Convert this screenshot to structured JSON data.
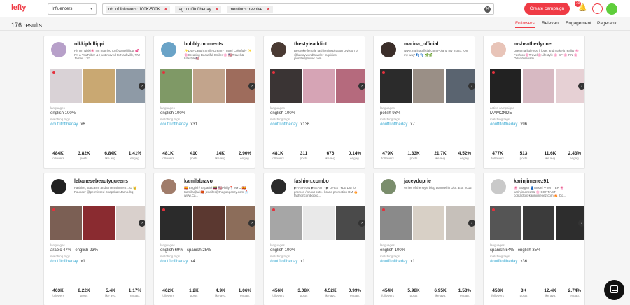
{
  "header": {
    "logo": "lefty",
    "type_dropdown": "Influencers",
    "chips": [
      {
        "label": "nb. of followers:",
        "value": "100K-500K"
      },
      {
        "label": "tag:",
        "value": "outfitoftheday"
      },
      {
        "label": "mentions:",
        "value": "revolve"
      }
    ],
    "chip_close": "✕",
    "create_campaign": "Create campaign",
    "notification_count": "10"
  },
  "results_count": "176 results",
  "sort_tabs": [
    "Followers",
    "Relevant",
    "Engagement",
    "Pagerank"
  ],
  "labels": {
    "languages": "languages",
    "matching_tags": "matching tags",
    "active_campaigns": "active campaigns",
    "followers": "followers",
    "posts": "posts",
    "like_avg": "like avg.",
    "engag": "engag."
  },
  "colors": {
    "accent": "#ef3b45",
    "tag": "#39a9d1",
    "online": "#5fce3b"
  },
  "cards": [
    {
      "handle": "nikkiphillippi",
      "bio": "Hi! I'm Nikki🌸 I'm married to @danphillippi 💕 I'm a YouTuber & I just moved to Nashville, TN! James 1:27",
      "campaign": "",
      "languages": "english 100%",
      "tag": "#outfitoftheday",
      "tag_count": "x6",
      "stats": [
        "484K",
        "3.82K",
        "6.84K",
        "1.41%"
      ]
    },
    {
      "handle": "bubbly.moments",
      "bio": "✨Live·Laugh·Smile·Dream·Travel Colorfully ✨ 🌸Creating Beautiful Smiles🌸 🇺🇸Travel & Lifestyle🇺🇸",
      "campaign": "",
      "languages": "english 100%",
      "tag": "#outfitoftheday",
      "tag_count": "x31",
      "stats": [
        "481K",
        "410",
        "14K",
        "2.90%"
      ]
    },
    {
      "handle": "thestyleaddict",
      "bio": "Bespoke female fashion inspiration Division of @luxuryworldtraveler Inquiries: jennifer@luxwt.com",
      "campaign": "",
      "languages": "english 100%",
      "tag": "#outfitoftheday",
      "tag_count": "x136",
      "stats": [
        "481K",
        "311",
        "676",
        "0.14%"
      ]
    },
    {
      "handle": "marina_official",
      "bio": "www.marinaofficial.com Poland my motto: 'On my way' 👣👣 🌿🌿",
      "campaign": "",
      "languages": "polish 93%",
      "tag": "#outfitoftheday",
      "tag_count": "x7",
      "stats": [
        "479K",
        "1.33K",
        "21.7K",
        "4.52%"
      ]
    },
    {
      "handle": "msheatherlynne",
      "bio": "Dream a little you'll love, and make it reality 🌸 Fashion🌸Travel🌸Lifestyle 🌸 SF 🌸 RN 🌸Orlando/Miami",
      "campaign": "MAMONDE",
      "languages": "",
      "tag": "#outfitoftheday",
      "tag_count": "x96",
      "stats": [
        "477K",
        "513",
        "11.6K",
        "2.43%"
      ]
    },
    {
      "handle": "lebanesebeautyqueens",
      "bio": "Fashion, Sarcasm and Entertainment ...ω 👑 Founder @permissed Snapchat: Jamo.lbq",
      "campaign": "",
      "languages": "arabic 47% · english 23%",
      "tag": "#outfitoftheday",
      "tag_count": "x1",
      "stats": [
        "463K",
        "8.22K",
        "5.4K",
        "1.17%"
      ]
    },
    {
      "handle": "kamilabravo",
      "bio": "🇪🇸 English/ Español 🇨🇴 🇺🇸Philly📍 NYC 🇪🇸 Kamila@wi 🇪🇸 jennifer@thegoogency.com 📩 www.Ca...",
      "campaign": "",
      "languages": "english 69% · spanish 25%",
      "tag": "#outfitoftheday",
      "tag_count": "x4",
      "stats": [
        "462K",
        "1.2K",
        "4.9K",
        "1.06%"
      ]
    },
    {
      "handle": "fashion.combo",
      "bio": "▶FASHION ▶BEAUTY▶ LIFESTYLE DM for promos / shout outs / brand promotion DM 🔥 fashioncombopro...",
      "campaign": "",
      "languages": "english 100%",
      "tag": "#outfitoftheday",
      "tag_count": "x1",
      "stats": [
        "456K",
        "3.08K",
        "4.52K",
        "0.99%"
      ]
    },
    {
      "handle": "jaceyduprie",
      "bio": "Writer of the style blog Damsel in Dior. Est. 2012",
      "campaign": "",
      "languages": "english 100%",
      "tag": "#outfitoftheday",
      "tag_count": "x1",
      "stats": [
        "454K",
        "5.98K",
        "6.95K",
        "1.53%"
      ]
    },
    {
      "handle": "karinjimenez91",
      "bio": "🌸 Blogger 👗Model ✈ WITTER 🌸karinjimenez91 🌸 CONTACT contacto@karinjimenez.com 🔥 Co...",
      "campaign": "",
      "languages": "spanish 54% · english 35%",
      "tag": "#outfitoftheday",
      "tag_count": "x36",
      "stats": [
        "453K",
        "3K",
        "12.4K",
        "2.74%"
      ]
    }
  ]
}
